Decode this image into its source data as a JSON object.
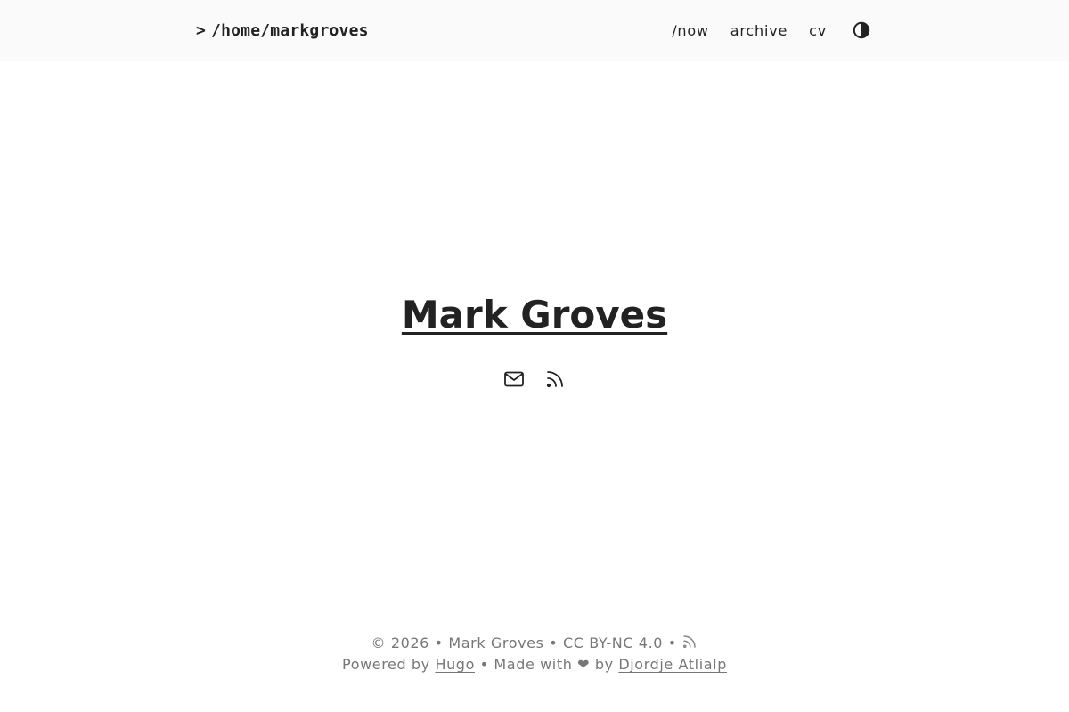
{
  "header": {
    "logo_prompt": ">",
    "logo_text": "/home/markgroves",
    "nav": [
      "/now",
      "archive",
      "cv"
    ],
    "theme_toggle_icon": "contrast-icon"
  },
  "hero": {
    "title": "Mark Groves",
    "social_icons": [
      "mail-icon",
      "rss-icon"
    ]
  },
  "footer": {
    "copyright": "© 2026",
    "sep": "•",
    "author_link": "Mark Groves",
    "license_link": "CC BY-NC 4.0",
    "powered_by": "Powered by",
    "hugo_link": "Hugo",
    "made_with": "Made with",
    "heart": "❤",
    "by": "by",
    "theme_author_link": "Djordje Atlialp"
  },
  "colors": {
    "header_bg": "#fafafa",
    "text": "#222222",
    "muted": "#777777",
    "background": "#ffffff"
  }
}
